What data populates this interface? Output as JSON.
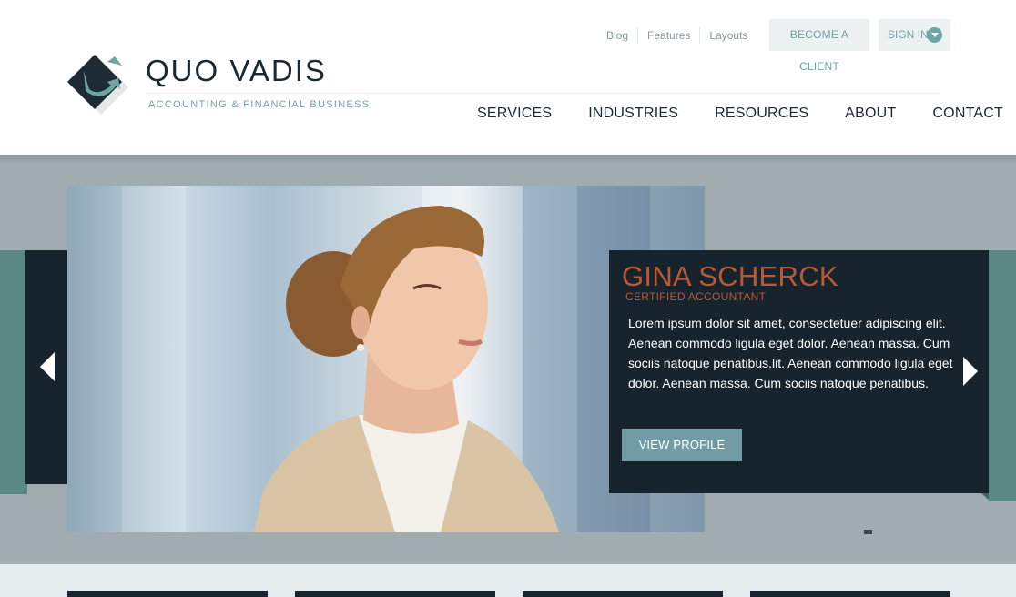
{
  "brand": {
    "name": "QUO VADIS",
    "tagline": "ACCOUNTING & FINANCIAL BUSINESS"
  },
  "top_links": [
    {
      "label": "Blog"
    },
    {
      "label": "Features"
    },
    {
      "label": "Layouts"
    }
  ],
  "header_buttons": {
    "become_client": "BECOME A CLIENT",
    "sign_in": "SIGN IN"
  },
  "main_nav": [
    {
      "label": "SERVICES"
    },
    {
      "label": "INDUSTRIES"
    },
    {
      "label": "RESOURCES"
    },
    {
      "label": "ABOUT"
    },
    {
      "label": "CONTACT"
    }
  ],
  "slider": {
    "name": "GINA SCHERCK",
    "title": "CERTIFIED ACCOUNTANT",
    "text": "Lorem ipsum dolor sit amet, consectetuer adipiscing elit. Aenean commodo ligula eget dolor. Aenean massa. Cum sociis natoque penatibus.lit. Aenean commodo ligula eget dolor. Aenean massa. Cum sociis natoque penatibus.",
    "button": "VIEW PROFILE",
    "icons": {
      "prev": "arrow-left-icon",
      "next": "arrow-right-icon",
      "signin": "chevron-down-icon"
    }
  },
  "colors": {
    "dark_navy": "#17232d",
    "teal": "#6fa4a4",
    "accent_orange": "#b75a36",
    "hero_bg": "#a0acb0"
  }
}
